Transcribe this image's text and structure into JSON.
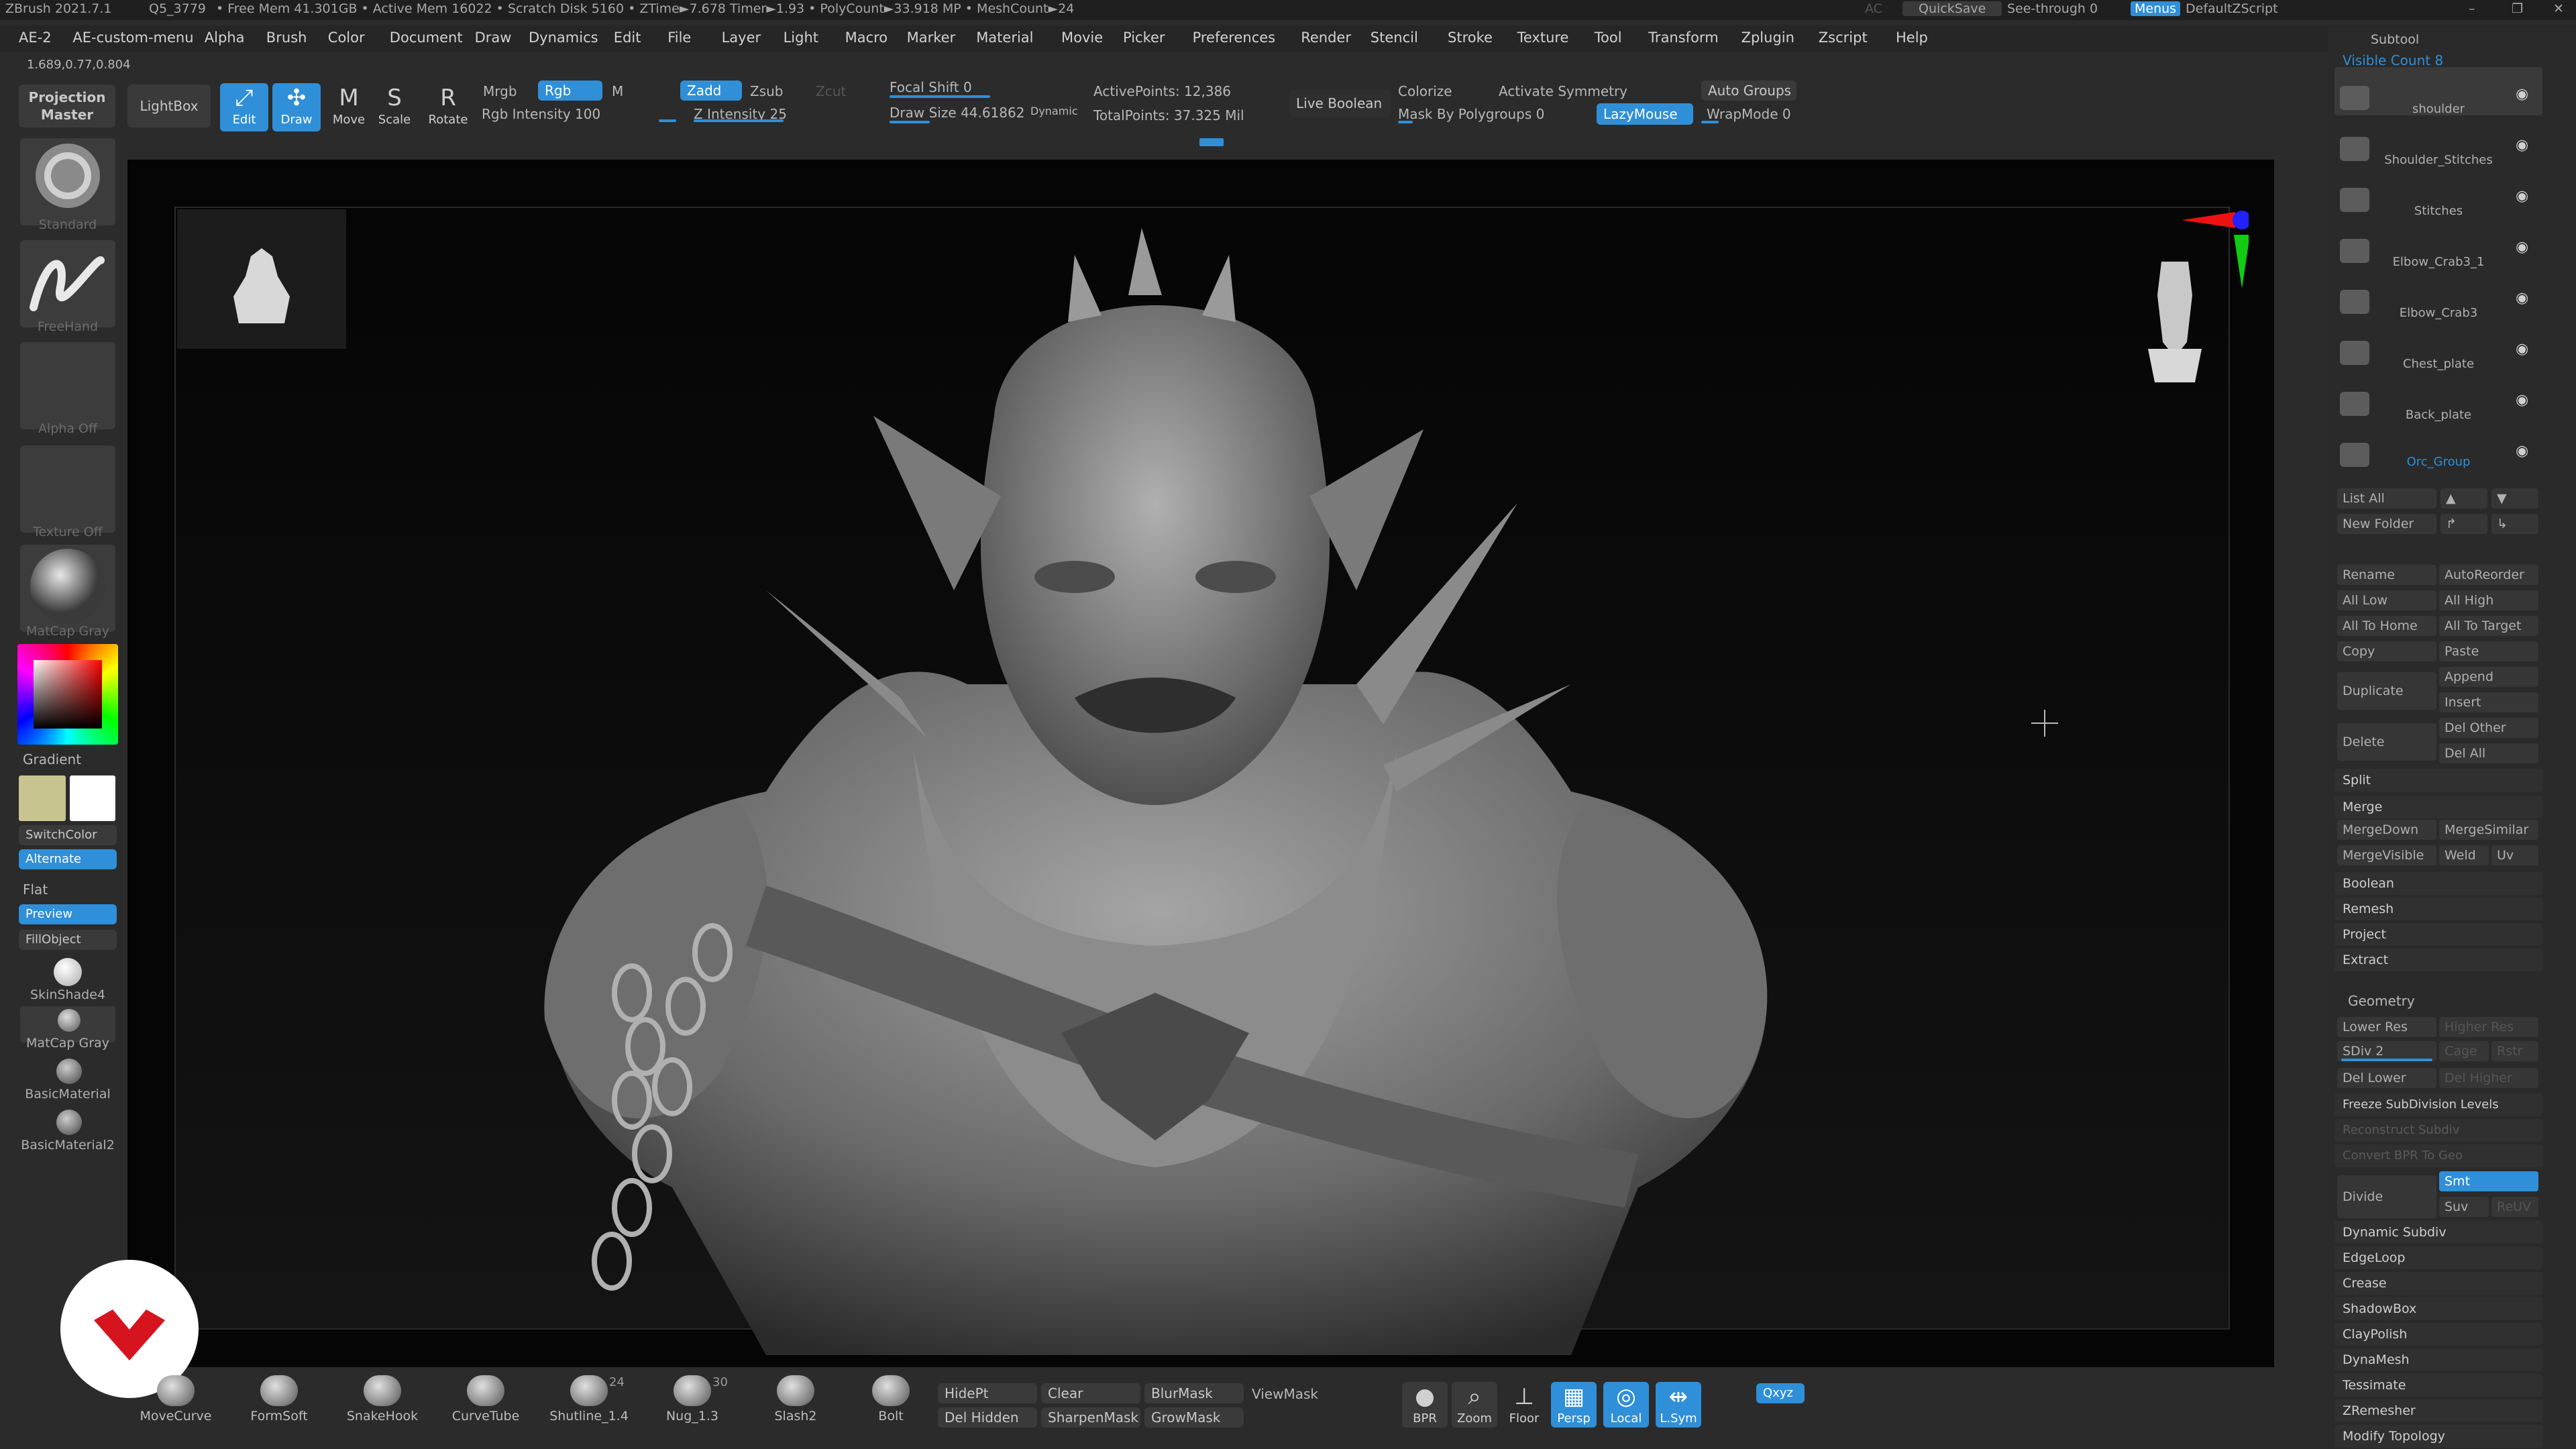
{
  "titlebar": {
    "app": "ZBrush 2021.7.1",
    "doc": "Q5_3779",
    "stats": "• Free Mem 41.301GB • Active Mem 16022 • Scratch Disk 5160 • ZTime►7.678 Timer►1.93 • PolyCount►33.918 MP • MeshCount►24",
    "ac": "AC",
    "quicksave": "QuickSave",
    "see_through": "See-through  0",
    "menus": "Menus",
    "default_zscript": "DefaultZScript"
  },
  "coords": "1.689,0.77,0.804",
  "menu": [
    "AE-2",
    "AE-custom-menu",
    "Alpha",
    "Brush",
    "Color",
    "Document",
    "Draw",
    "Dynamics",
    "Edit",
    "File",
    "Layer",
    "Light",
    "Macro",
    "Marker",
    "Material",
    "Movie",
    "Picker",
    "Preferences",
    "Render",
    "Stencil",
    "Stroke",
    "Texture",
    "Tool",
    "Transform",
    "Zplugin",
    "Zscript",
    "Help"
  ],
  "toolbar": {
    "projection_master": "Projection Master",
    "lightbox": "LightBox",
    "edit": "Edit",
    "draw": "Draw",
    "move": "Move",
    "scale": "Scale",
    "rotate": "Rotate",
    "mrgb": "Mrgb",
    "rgb": "Rgb",
    "m": "M",
    "rgb_intensity": "Rgb Intensity 100",
    "zadd": "Zadd",
    "zsub": "Zsub",
    "zcut": "Zcut",
    "z_intensity": "Z Intensity 25",
    "focal_shift": "Focal Shift 0",
    "draw_size": "Draw Size 44.61862",
    "dynamic": "Dynamic",
    "active_points": "ActivePoints: 12,386",
    "total_points": "TotalPoints: 37.325 Mil",
    "live_boolean": "Live Boolean",
    "colorize": "Colorize",
    "activate_symmetry": "Activate Symmetry",
    "mask_by_polygroups": "Mask By Polygroups 0",
    "lazymouse": "LazyMouse",
    "auto_groups": "Auto Groups",
    "wrapmode": "WrapMode 0"
  },
  "shelf": {
    "standard": "Standard",
    "freehand": "FreeHand",
    "alpha_off": "Alpha Off",
    "texture_off": "Texture Off",
    "matcap_gray": "MatCap Gray",
    "gradient": "Gradient",
    "switchcolor": "SwitchColor",
    "alternate": "Alternate",
    "flat": "Flat",
    "preview": "Preview",
    "fillobject": "FillObject",
    "skinshade4": "SkinShade4",
    "matcap_gray2": "MatCap Gray",
    "basicmaterial": "BasicMaterial",
    "basicmaterial2": "BasicMaterial2",
    "color_main": "#c8c490",
    "color_secondary": "#ffffff"
  },
  "subtool": {
    "header": "Subtool",
    "visible_count": "Visible Count 8",
    "items": [
      "shoulder",
      "Shoulder_Stitches",
      "Stitches",
      "Elbow_Crab3_1",
      "Elbow_Crab3",
      "Chest_plate",
      "Back_plate",
      "Orc_Group"
    ],
    "list_all": "List All",
    "new_folder": "New Folder",
    "rename": "Rename",
    "autoreorder": "AutoReorder",
    "all_low": "All Low",
    "all_high": "All High",
    "all_to_home": "All To Home",
    "all_to_target": "All To Target",
    "copy": "Copy",
    "paste": "Paste",
    "duplicate": "Duplicate",
    "append": "Append",
    "insert": "Insert",
    "delete": "Delete",
    "del_other": "Del Other",
    "del_all": "Del All",
    "split": "Split",
    "merge": "Merge",
    "mergedown": "MergeDown",
    "mergesimilar": "MergeSimilar",
    "mergevisible": "MergeVisible",
    "weld": "Weld",
    "uv": "Uv",
    "boolean": "Boolean",
    "remesh": "Remesh",
    "project": "Project",
    "extract": "Extract"
  },
  "geometry": {
    "header": "Geometry",
    "lower_res": "Lower Res",
    "higher_res": "Higher Res",
    "sdiv": "SDiv 2",
    "cage": "Cage",
    "rstr": "Rstr",
    "del_lower": "Del Lower",
    "del_higher": "Del Higher",
    "freeze": "Freeze SubDivision Levels",
    "reconstruct": "Reconstruct Subdiv",
    "convert_bpr": "Convert BPR To Geo",
    "divide": "Divide",
    "smt": "Smt",
    "suv": "Suv",
    "reuv": "ReUV",
    "items": [
      "Dynamic Subdiv",
      "EdgeLoop",
      "Crease",
      "ShadowBox",
      "ClayPolish",
      "DynaMesh",
      "Tessimate",
      "ZRemesher",
      "Modify Topology"
    ]
  },
  "brushes": [
    {
      "name": "MoveCurve",
      "count": ""
    },
    {
      "name": "FormSoft",
      "count": ""
    },
    {
      "name": "SnakeHook",
      "count": ""
    },
    {
      "name": "CurveTube",
      "count": ""
    },
    {
      "name": "Shutline_1.4",
      "count": "24"
    },
    {
      "name": "Nug_1.3",
      "count": "30"
    },
    {
      "name": "Slash2",
      "count": ""
    },
    {
      "name": "Bolt",
      "count": ""
    }
  ],
  "bottom": {
    "hidept": "HidePt",
    "clear": "Clear",
    "blurmask": "BlurMask",
    "viewmask": "ViewMask",
    "del_hidden": "Del Hidden",
    "sharpenmask": "SharpenMask",
    "growmask": "GrowMask",
    "bpr": "BPR",
    "zoom": "Zoom",
    "floor": "Floor",
    "persp": "Persp",
    "local": "Local",
    "lsym": "L.Sym",
    "xyz": "Qxyz"
  },
  "colors": {
    "accent": "#2f8fd8",
    "panel": "#2b2b2b",
    "viewport": "#050505"
  }
}
